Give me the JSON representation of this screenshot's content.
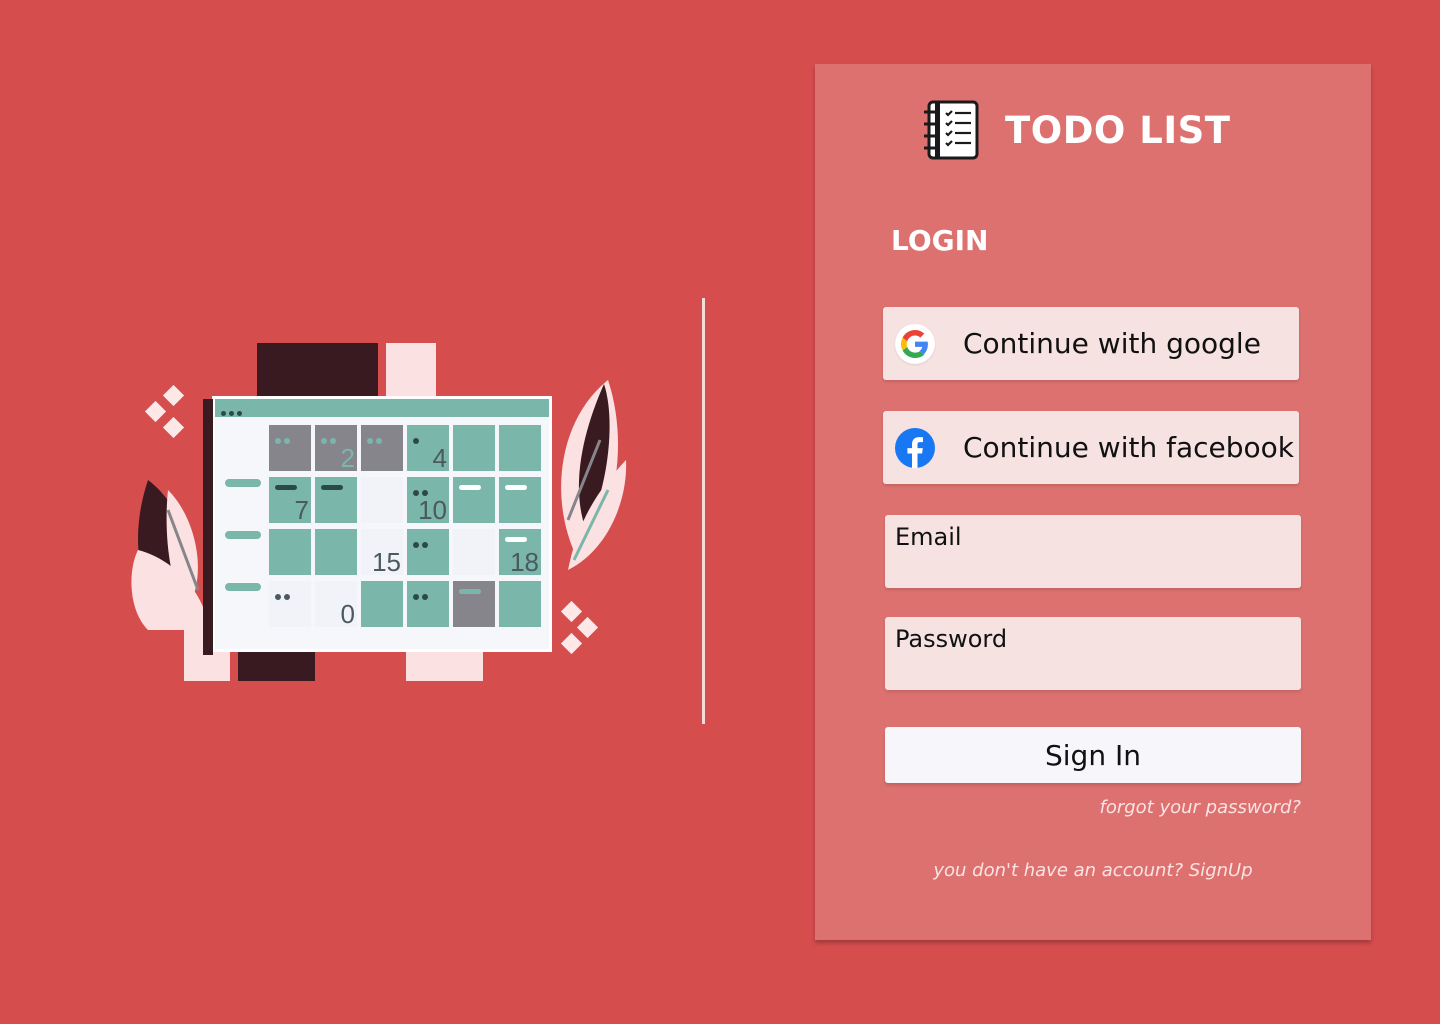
{
  "app": {
    "title": "TODO LIST",
    "logo_icon": "notebook-checklist-icon"
  },
  "colors": {
    "background": "#d64d4e",
    "card": "#dd7170",
    "button_bg": "#f7e2e2",
    "signin_bg": "#f6f6fb",
    "illustration_teal": "#7bb6aa"
  },
  "login": {
    "heading": "LOGIN",
    "google_label": "Continue with google",
    "google_icon": "google-icon",
    "facebook_label": "Continue with facebook",
    "facebook_icon": "facebook-icon",
    "email_label": "Email",
    "email_value": "",
    "password_label": "Password",
    "password_value": "",
    "signin_label": "Sign In",
    "forgot_label": "forgot your password?",
    "signup_prefix": "you don't have an account? ",
    "signup_link": "SignUp"
  },
  "illustration": {
    "calendar_numbers": [
      "2",
      "4",
      "7",
      "10",
      "15",
      "18",
      "0"
    ]
  }
}
